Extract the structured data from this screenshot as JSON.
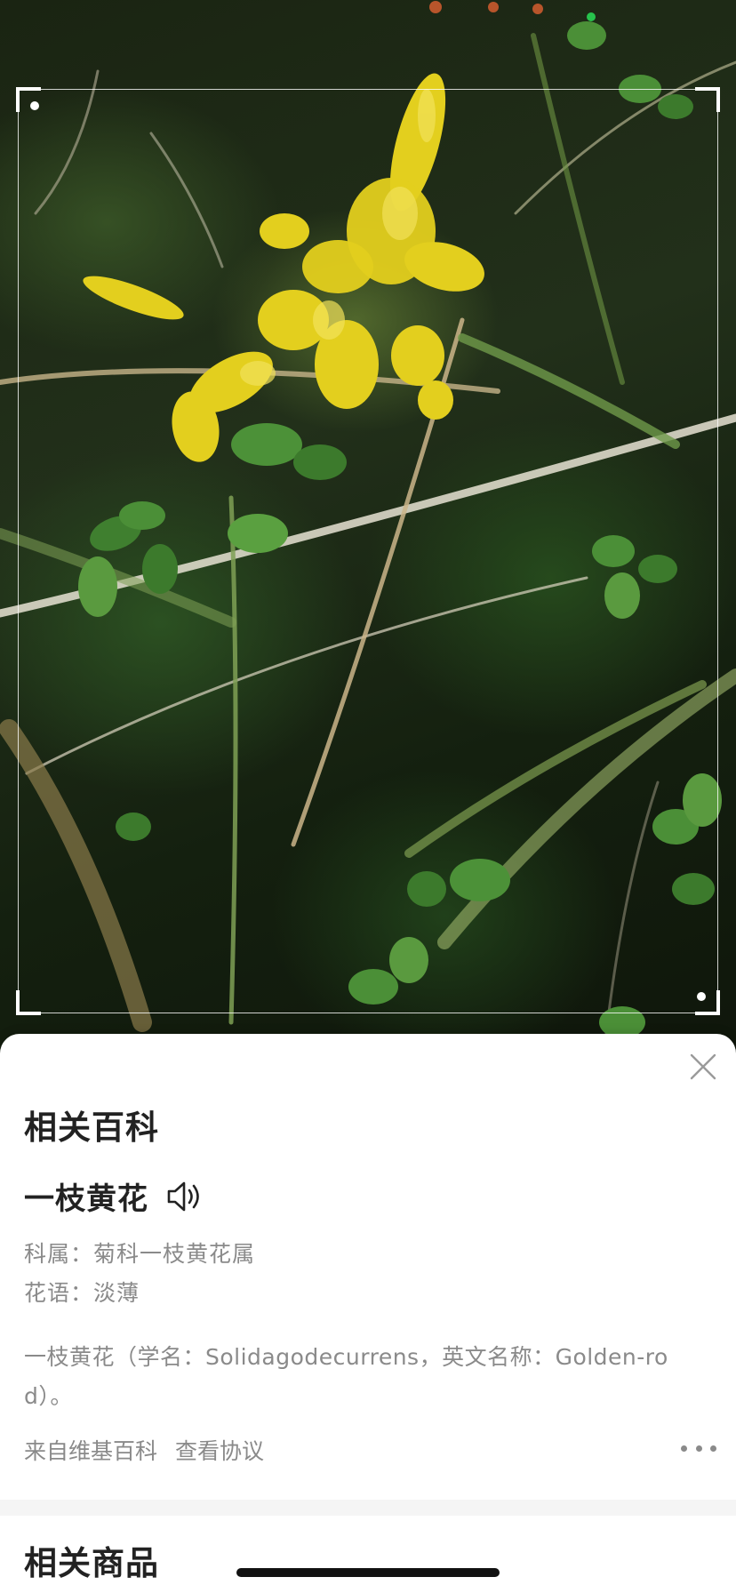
{
  "sheet": {
    "wiki_section_title": "相关百科",
    "plant_name": "一枝黄花",
    "family_line": "科属：菊科一枝黄花属",
    "flower_language_line": "花语：淡薄",
    "description": "一枝黄花（学名：Solidagodecurrens，英文名称：Golden-rod）。",
    "source_text": "来自维基百科",
    "agreement_link": "查看协议",
    "goods_section_title": "相关商品"
  },
  "icons": {
    "close": "close-icon",
    "speaker": "speaker-icon",
    "more": "more-dots-icon"
  },
  "colors": {
    "accent_dot": "#27c24c",
    "flower_yellow": "#e3cf1e",
    "secondary_text": "#8a8a8a",
    "primary_text": "#222222"
  }
}
